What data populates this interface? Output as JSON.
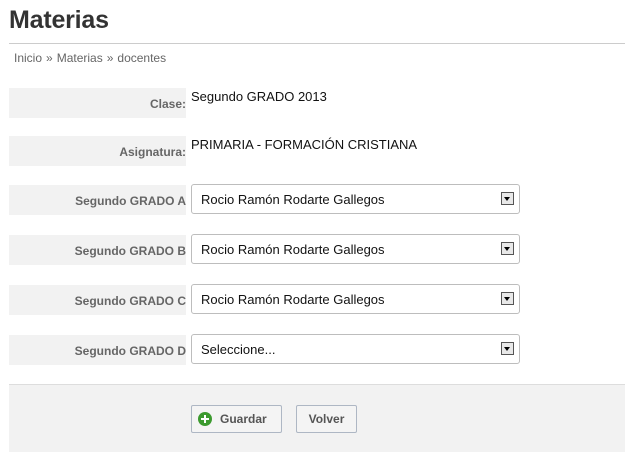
{
  "page": {
    "title": "Materias"
  },
  "breadcrumb": {
    "items": [
      "Inicio",
      "Materias",
      "docentes"
    ],
    "separator": "»"
  },
  "form": {
    "clase": {
      "label": "Clase:",
      "value": "Segundo GRADO 2013"
    },
    "asignatura": {
      "label": "Asignatura:",
      "value": "PRIMARIA - FORMACIÓN CRISTIANA"
    },
    "grades": [
      {
        "label": "Segundo GRADO A",
        "selected": "Rocio Ramón Rodarte Gallegos"
      },
      {
        "label": "Segundo GRADO B",
        "selected": "Rocio Ramón Rodarte Gallegos"
      },
      {
        "label": "Segundo GRADO C",
        "selected": "Rocio Ramón Rodarte Gallegos"
      },
      {
        "label": "Segundo GRADO D",
        "selected": "Seleccione..."
      }
    ]
  },
  "actions": {
    "save_label": "Guardar",
    "back_label": "Volver"
  },
  "icons": {
    "save": "plus-circle-icon",
    "dropdown": "dropdown-arrow-icon"
  },
  "colors": {
    "save_icon": "#3c9a2f",
    "label_bg": "#f2f2f2",
    "label_text": "#666666"
  }
}
